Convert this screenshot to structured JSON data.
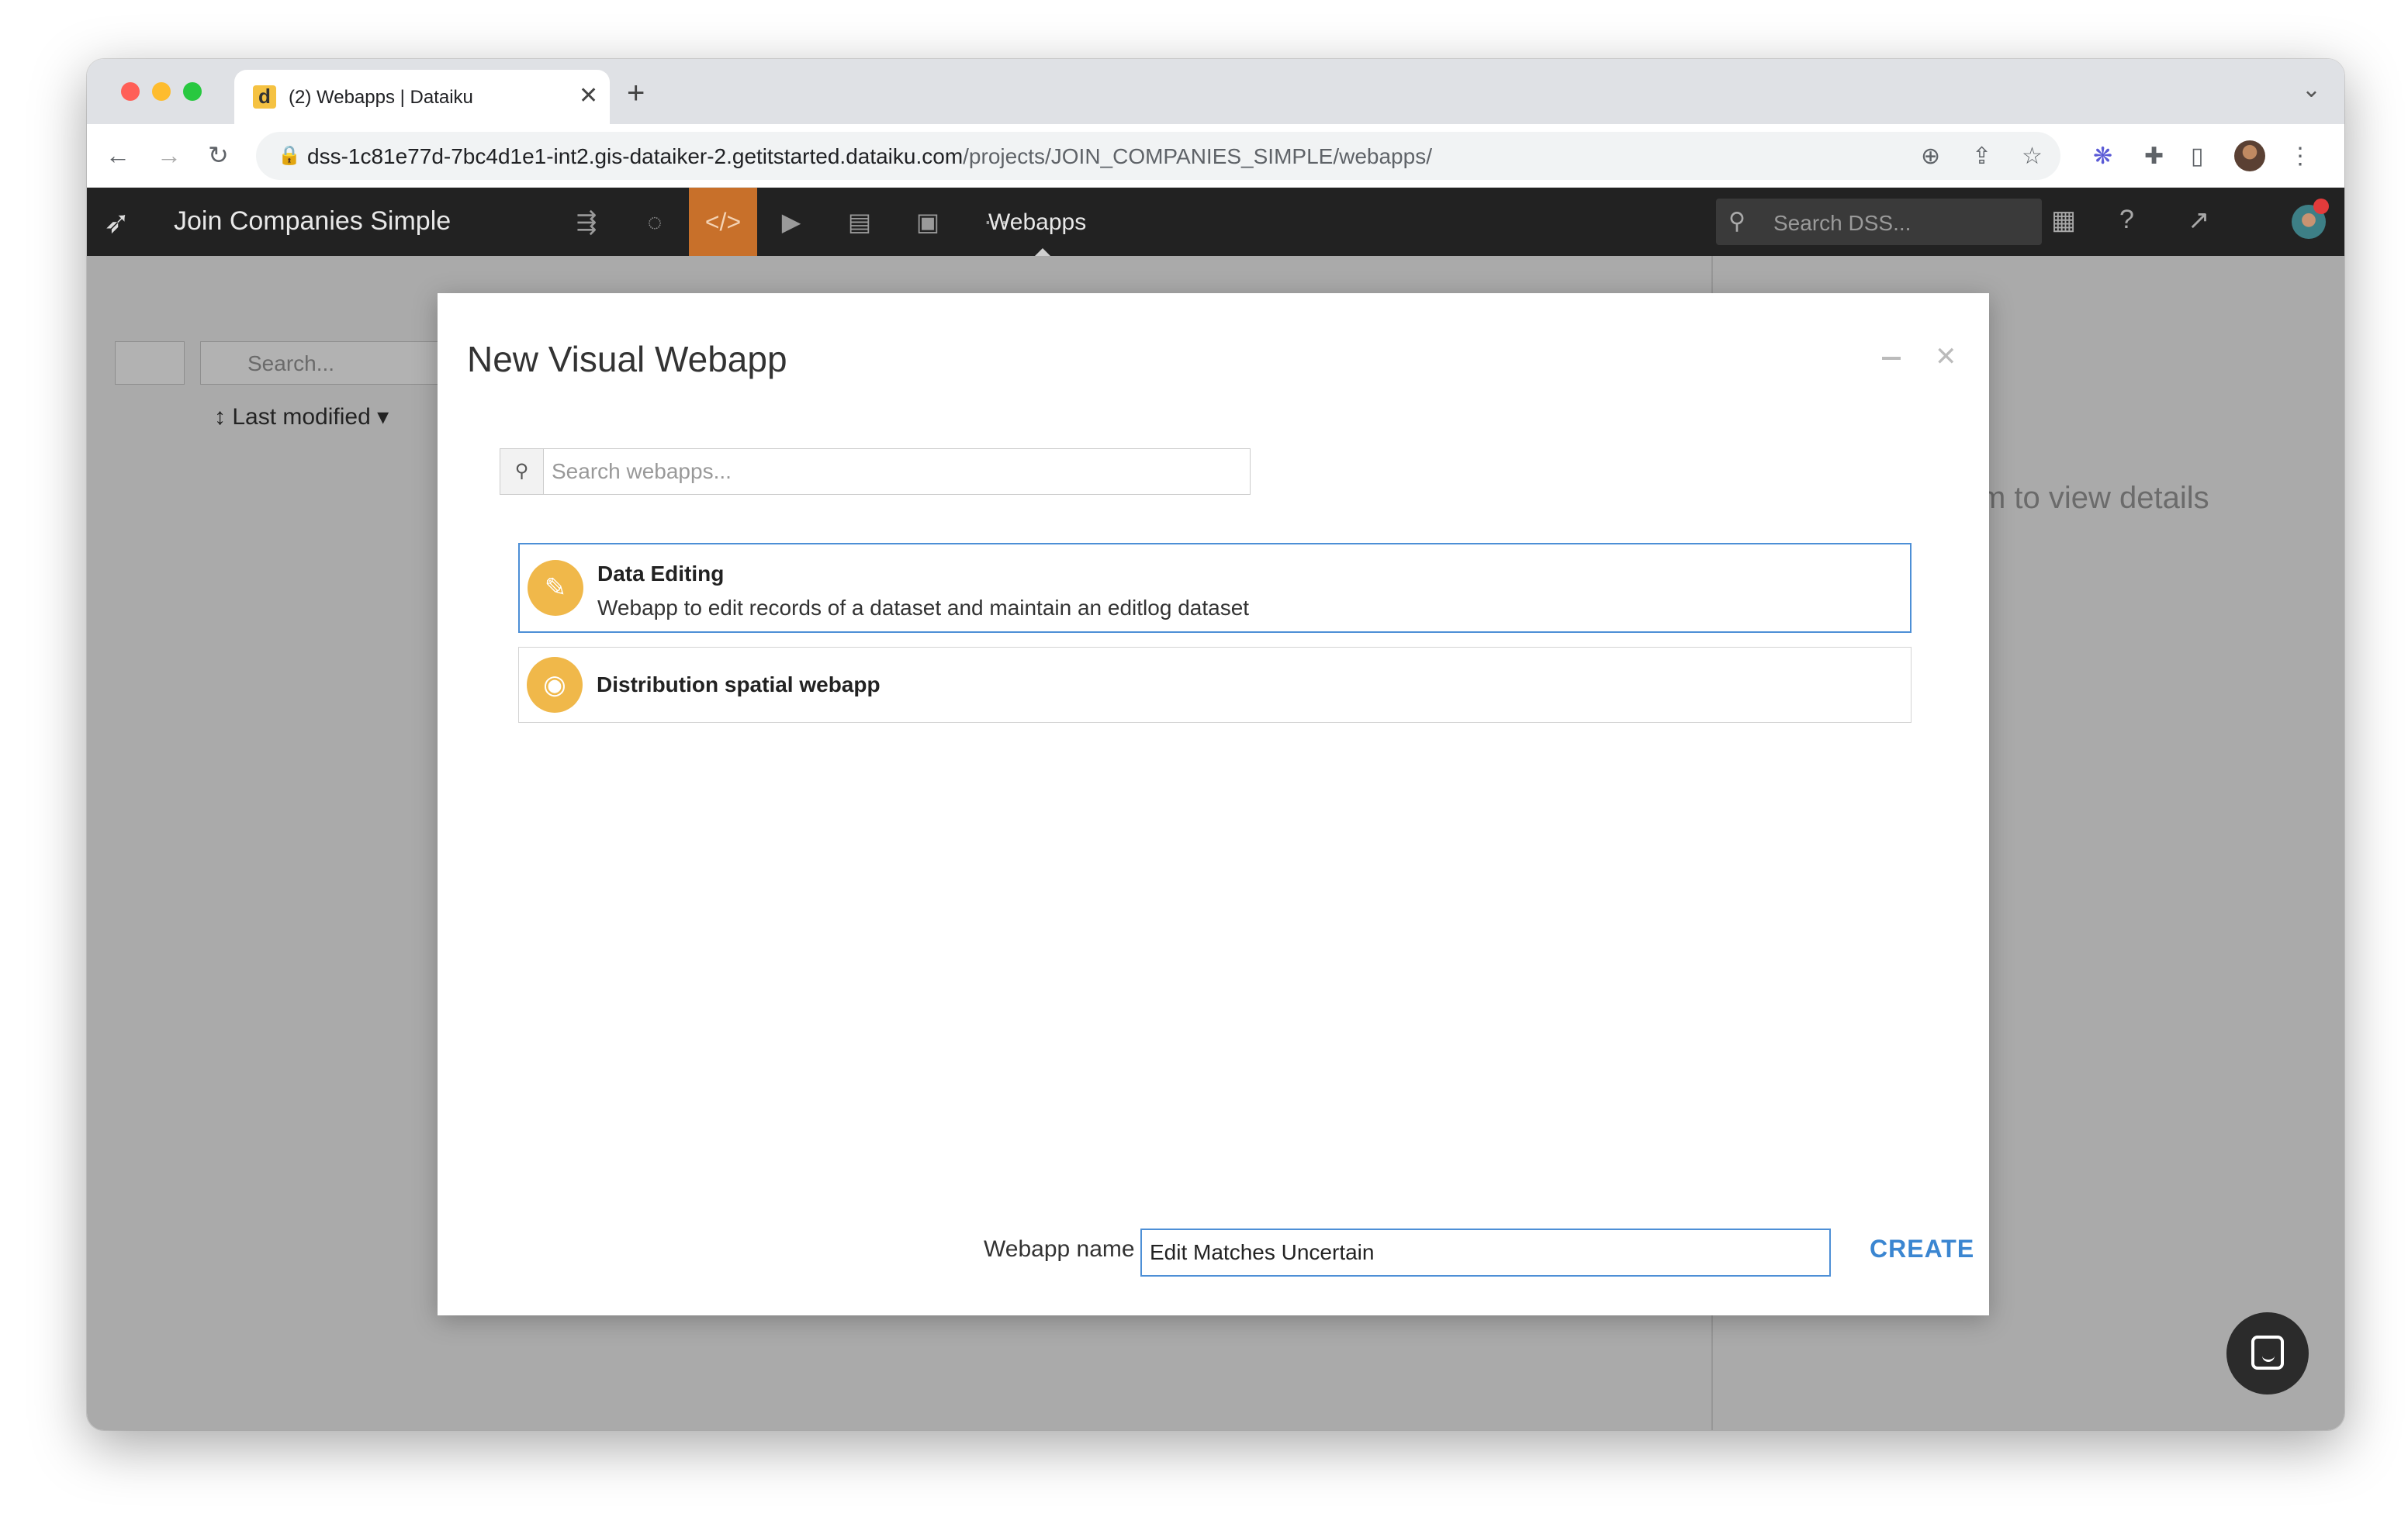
{
  "browser": {
    "tab_favicon": "d",
    "tab_title": "(2) Webapps | Dataiku",
    "tab_close": "✕",
    "new_tab": "+",
    "url_host": "dss-1c81e77d-7bc4d1e1-int2.gis-dataiker-2.getitstarted.dataiku.com",
    "url_path": "/projects/JOIN_COMPANIES_SIMPLE/webapps/"
  },
  "dss": {
    "project_title": "Join Companies Simple",
    "section_title": "Webapps",
    "search_placeholder": "Search DSS...",
    "accent_color": "#c8702a"
  },
  "background_page": {
    "search_placeholder": "Search...",
    "sort_label": "Last modified",
    "details_hint": "m to view details"
  },
  "modal": {
    "title": "New Visual Webapp",
    "search_placeholder": "Search webapps...",
    "items": [
      {
        "name": "Data Editing",
        "description": "Webapp to edit records of a dataset and maintain an editlog dataset",
        "icon": "pencil-icon",
        "selected": true
      },
      {
        "name": "Distribution spatial webapp",
        "description": "",
        "icon": "globe-icon",
        "selected": false
      }
    ],
    "webapp_name_label": "Webapp name",
    "webapp_name_value": "Edit Matches Uncertain",
    "create_label": "CREATE"
  }
}
